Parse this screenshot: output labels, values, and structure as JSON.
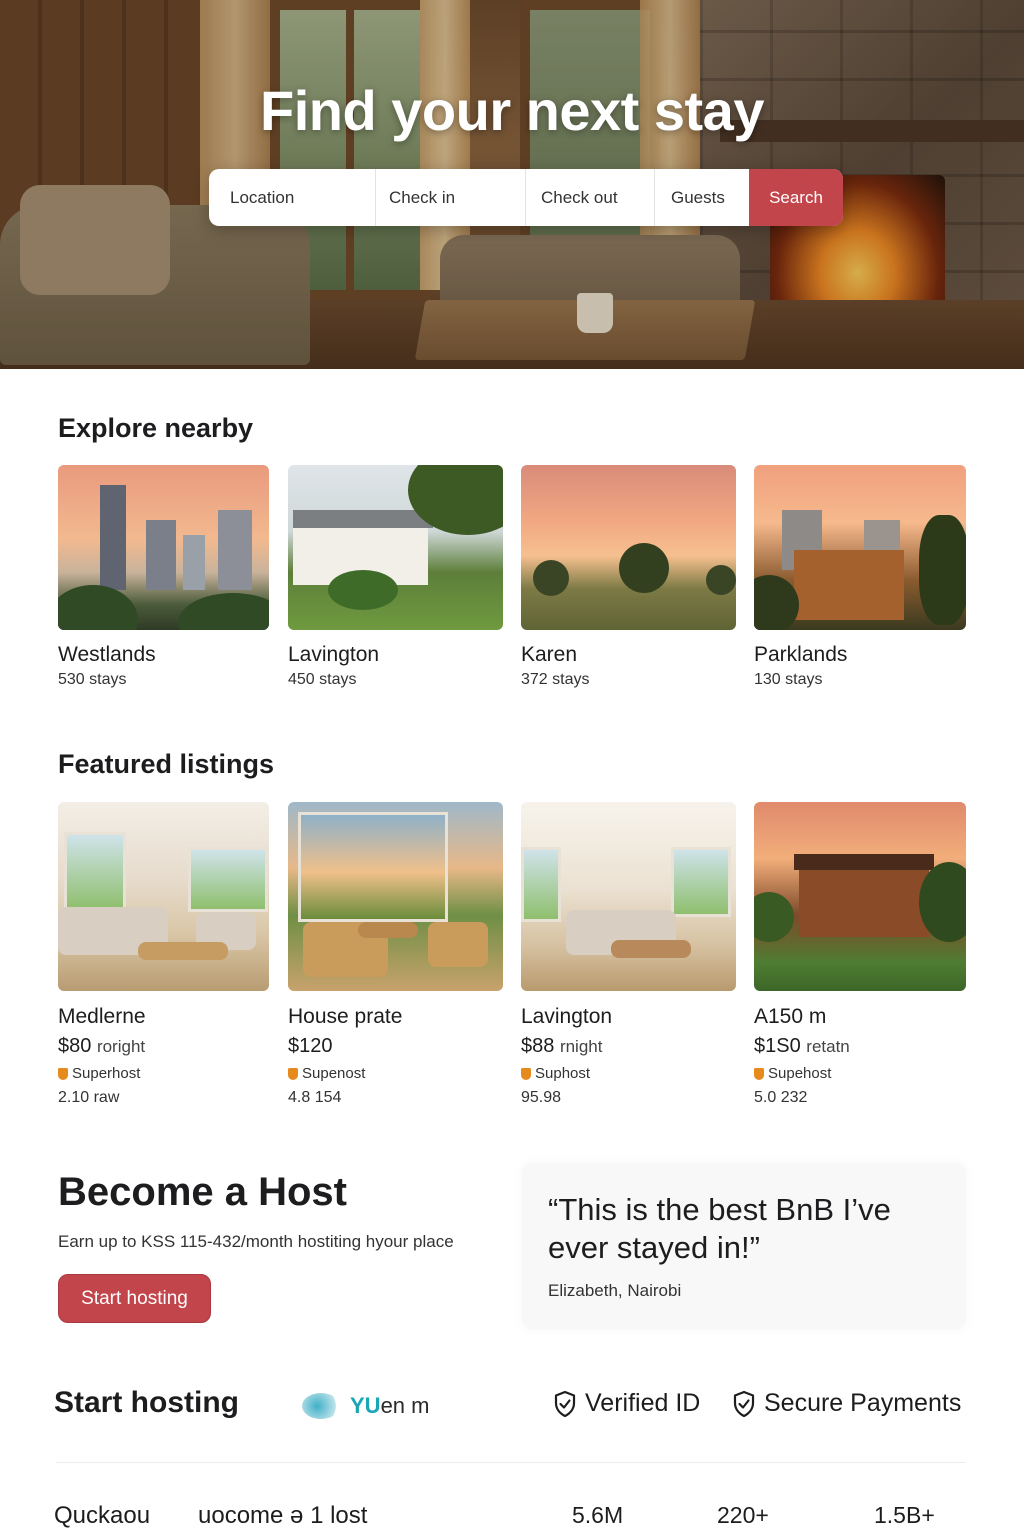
{
  "hero": {
    "title": "Find your next stay",
    "search": {
      "location_placeholder": "Location",
      "checkin_placeholder": "Check in",
      "checkout_placeholder": "Check out",
      "guests_placeholder": "Guests",
      "button_label": "Search"
    }
  },
  "explore": {
    "title": "Explore nearby",
    "items": [
      {
        "name": "Westlands",
        "stays": "530 stays"
      },
      {
        "name": "Lavington",
        "stays": "450 stays"
      },
      {
        "name": "Karen",
        "stays": "372 stays"
      },
      {
        "name": "Parklands",
        "stays": "130 stays"
      }
    ]
  },
  "featured": {
    "title": "Featured listings",
    "items": [
      {
        "name": "Medlerne",
        "price": "$80",
        "unit": "roright",
        "badge": "Superhost",
        "rating": "2.10 raw"
      },
      {
        "name": "House prate",
        "price": "$120",
        "unit": "",
        "badge": "Supenost",
        "rating": "4.8 154"
      },
      {
        "name": "Lavington",
        "price": "$88",
        "unit": "rnight",
        "badge": "Suphost",
        "rating": "95.98"
      },
      {
        "name": "A150 m",
        "price": "$1S0",
        "unit": "retatn",
        "badge": "Supehost",
        "rating": "5.0 232"
      }
    ]
  },
  "host": {
    "title": "Become a Host",
    "subtitle": "Earn up to KSS 115-432/month hostiting hyour place",
    "button_label": "Start hosting",
    "quote": "“This is the best BnB I’ve ever stayed in!”",
    "quote_author": "Elizabeth, Nairobi"
  },
  "trust": {
    "title": "Start hosting",
    "logo_text_accent": "YU",
    "logo_text_rest": "en m",
    "items": [
      "Verified ID",
      "Secure Payments"
    ]
  },
  "stats": {
    "label_1": "Quckaou",
    "label_2": "uocome ə 1 lost",
    "values": [
      "5.6M",
      "220+",
      "1.5B+"
    ]
  },
  "colors": {
    "accent": "#c2454b",
    "badge": "#e68a1e",
    "text": "#1d1d1f"
  }
}
